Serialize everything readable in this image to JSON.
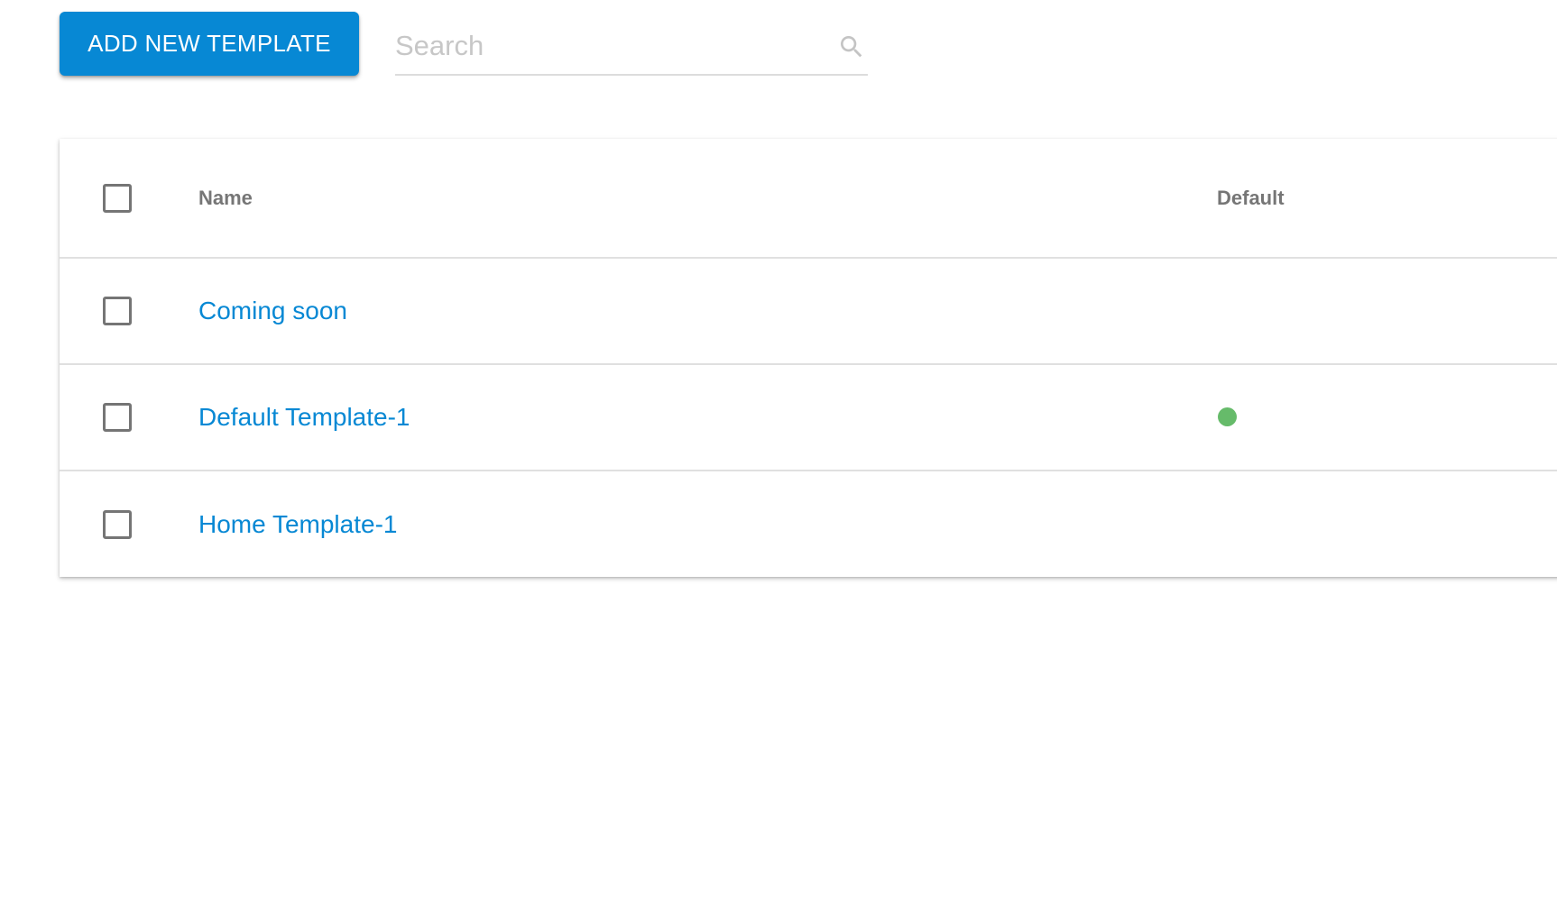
{
  "toolbar": {
    "add_button_label": "ADD NEW TEMPLATE",
    "search": {
      "placeholder": "Search",
      "value": "",
      "icon": "search-icon"
    }
  },
  "table": {
    "columns": [
      {
        "key": "select",
        "label": ""
      },
      {
        "key": "name",
        "label": "Name"
      },
      {
        "key": "default",
        "label": "Default"
      }
    ],
    "rows": [
      {
        "name": "Coming soon",
        "checked": false,
        "is_default": false
      },
      {
        "name": "Default Template-1",
        "checked": false,
        "is_default": true
      },
      {
        "name": "Home Template-1",
        "checked": false,
        "is_default": false
      }
    ]
  },
  "colors": {
    "primary": "#0788d4",
    "default_indicator": "#66bb6a",
    "header_text": "#767676",
    "checkbox_border": "#757575",
    "divider": "#e0e0e0"
  }
}
